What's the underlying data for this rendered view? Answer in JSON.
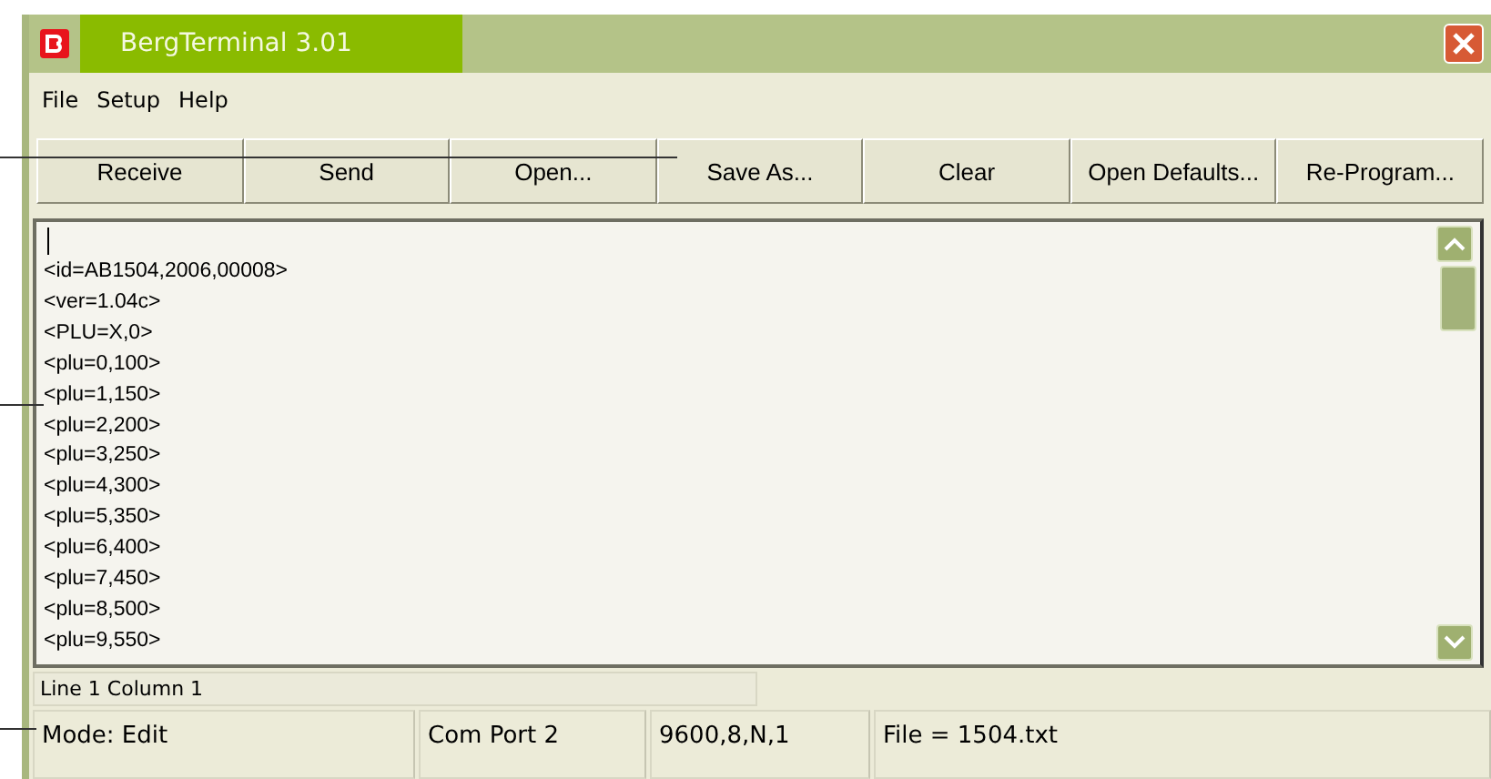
{
  "window": {
    "title": "BergTerminal 3.01"
  },
  "menu": [
    "File",
    "Setup",
    "Help"
  ],
  "buttons": [
    {
      "label": "Receive"
    },
    {
      "label": "Send"
    },
    {
      "label": "Open..."
    },
    {
      "label": "Save As..."
    },
    {
      "label": "Clear"
    },
    {
      "label": "Open Defaults..."
    },
    {
      "label": "Re-Program..."
    }
  ],
  "editor": {
    "lines": [
      "<id=AB1504,2006,00008>",
      "<ver=1.04c>",
      "<PLU=X,0>",
      "<plu=0,100>",
      "<plu=1,150>",
      "<plu=2,200>",
      "<plu=3,250>",
      "<plu=4,300>",
      "<plu=5,350>",
      "<plu=6,400>",
      "<plu=7,450>",
      "<plu=8,500>",
      "<plu=9,550>"
    ]
  },
  "cursor_position": "Line 1 Column 1",
  "status_bar": [
    "Mode: Edit",
    "Com Port 2",
    "9600,8,N,1",
    "File = 1504.txt"
  ]
}
